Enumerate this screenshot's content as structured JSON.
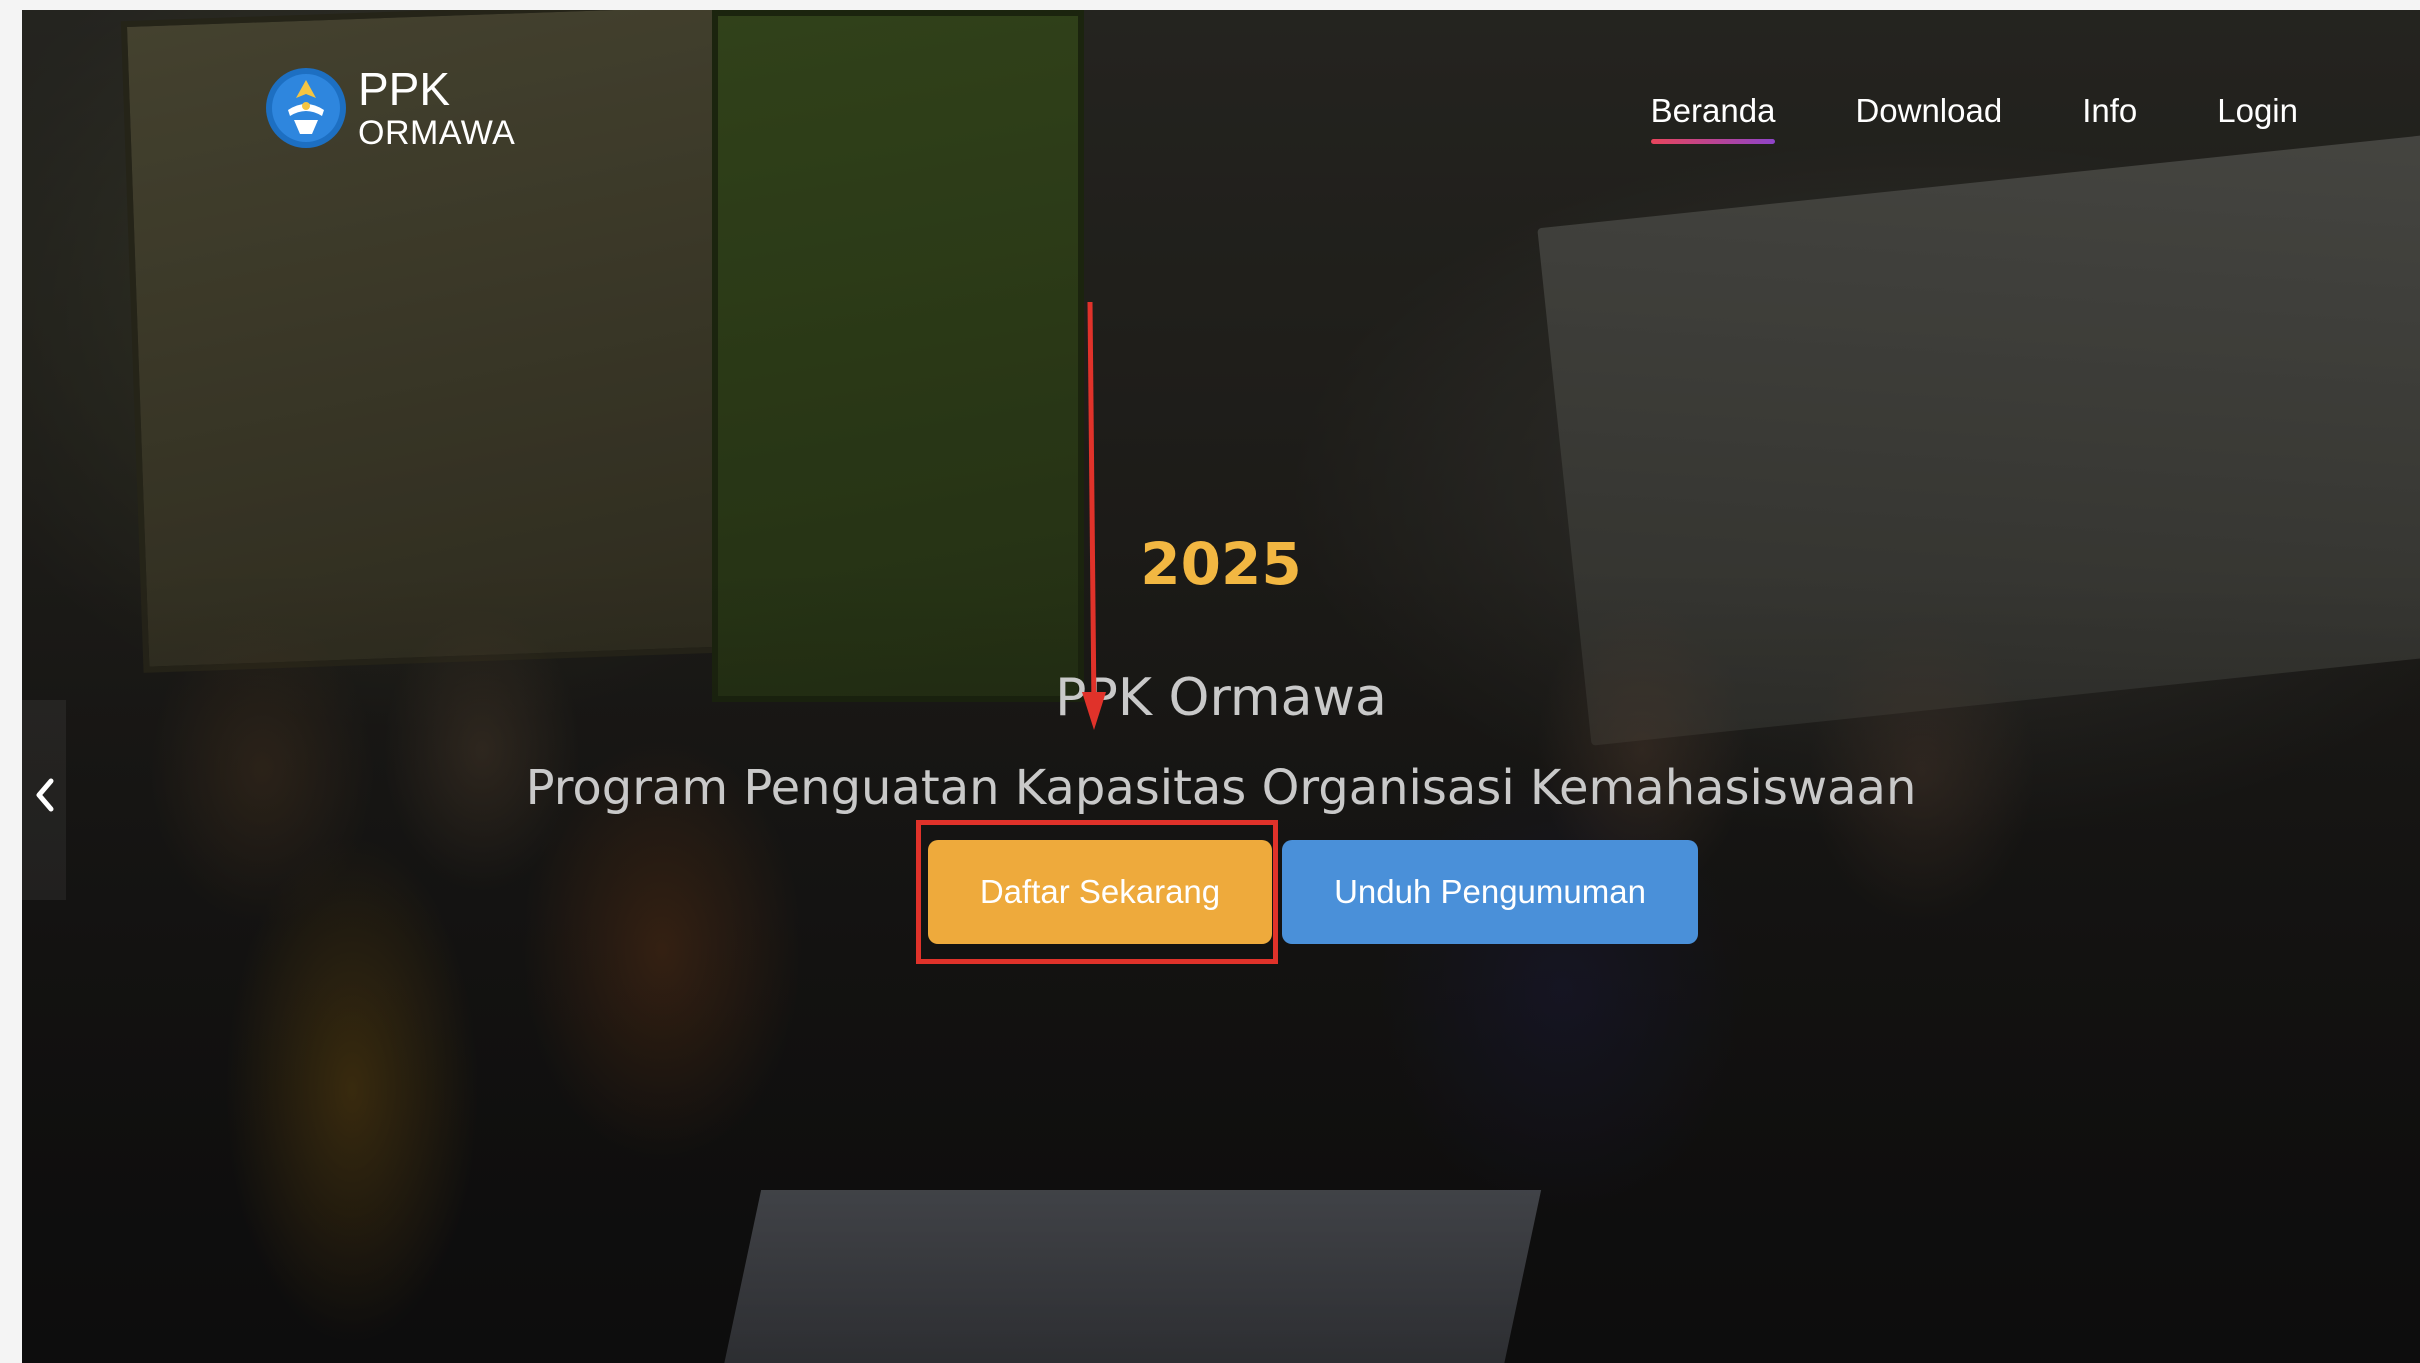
{
  "brand": {
    "name_top": "PPK",
    "name_bottom": "ORMAWA"
  },
  "nav": {
    "items": [
      {
        "label": "Beranda",
        "active": true
      },
      {
        "label": "Download",
        "active": false
      },
      {
        "label": "Info",
        "active": false
      },
      {
        "label": "Login",
        "active": false
      }
    ]
  },
  "hero": {
    "year": "2025",
    "title": "PPK Ormawa",
    "subtitle": "Program Penguatan Kapasitas Organisasi Kemahasiswaan",
    "primary_button": "Daftar Sekarang",
    "secondary_button": "Unduh Pengumuman"
  },
  "carousel": {
    "prev_icon": "chevron-left-icon"
  },
  "annotation": {
    "highlight_color": "#e0322a",
    "target": "Daftar Sekarang"
  },
  "colors": {
    "accent_yellow": "#eeaa3c",
    "accent_blue": "#4a90d9",
    "year_color": "#f2b742",
    "nav_underline_start": "#e8455c",
    "nav_underline_end": "#8e44c9"
  }
}
